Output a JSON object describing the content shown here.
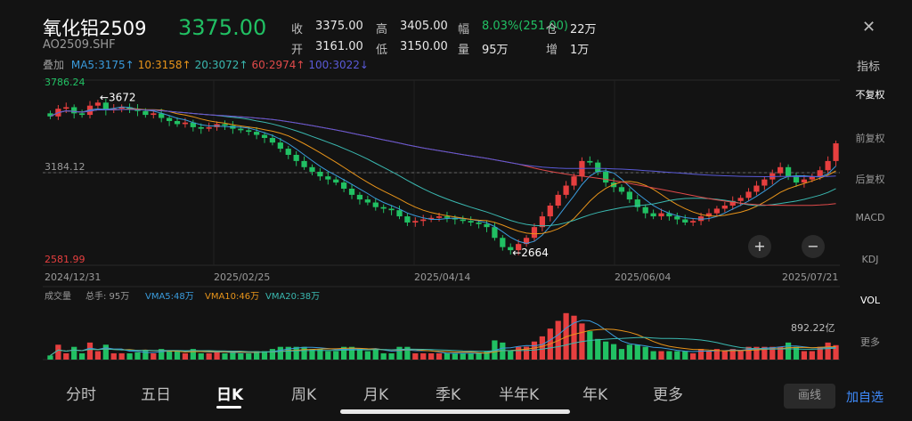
{
  "header": {
    "title": "氧化铝2509",
    "code": "AO2509.SHF",
    "price": "3375.00",
    "close_icon": "close-icon"
  },
  "quote": {
    "row1": [
      {
        "label": "收",
        "value": "3375.00"
      },
      {
        "label": "高",
        "value": "3405.00"
      },
      {
        "label": "幅",
        "value": "8.03%(251.00)"
      },
      {
        "label": "仓",
        "value": "22万"
      }
    ],
    "row2": [
      {
        "label": "开",
        "value": "3161.00"
      },
      {
        "label": "低",
        "value": "3150.00"
      },
      {
        "label": "量",
        "value": "95万"
      },
      {
        "label": "增",
        "value": "1万"
      }
    ]
  },
  "ma": {
    "overlay_label": "叠加",
    "items": [
      {
        "label": "MA5:",
        "value": "3175",
        "arrow": "↑",
        "color": "#3a9bdc"
      },
      {
        "label": "10:",
        "value": "3158",
        "arrow": "↑",
        "color": "#e8941a"
      },
      {
        "label": "20:",
        "value": "3072",
        "arrow": "↑",
        "color": "#3ab8b0"
      },
      {
        "label": "60:",
        "value": "2974",
        "arrow": "↑",
        "color": "#e04a4a"
      },
      {
        "label": "100:",
        "value": "3022",
        "arrow": "↓",
        "color": "#5a5ad8"
      }
    ]
  },
  "indicator_title": "指标",
  "right_menu": {
    "items": [
      "不复权",
      "前复权",
      "后复权",
      "MACD",
      "KDJ",
      "VOL",
      "更多"
    ],
    "active": [
      "不复权",
      "VOL"
    ]
  },
  "chart_labels": {
    "y_top": "3786.24",
    "y_mid": "3184.12",
    "y_bottom": "2581.99",
    "peak_label": "3672",
    "trough_label": "2664",
    "dates": [
      "2024/12/31",
      "2025/02/25",
      "2025/04/14",
      "2025/06/04",
      "2025/07/21"
    ]
  },
  "volume_header": {
    "title": "成交量",
    "total": "总手: 95万",
    "vma5": "VMA5:48万",
    "vma10": "VMA10:46万",
    "vma20": "VMA20:38万",
    "vol_label": "892.22亿"
  },
  "colors": {
    "up": "#e63f3f",
    "down": "#21c063",
    "ma5": "#3a9bdc",
    "ma10": "#e8941a",
    "ma20": "#3ab8b0",
    "ma60": "#e04a4a",
    "ma100": "#5a5ad8"
  },
  "bottom_tabs": {
    "items": [
      "分时",
      "五日",
      "日K",
      "周K",
      "月K",
      "季K",
      "半年K",
      "年K",
      "更多"
    ],
    "active": "日K"
  },
  "draw_button": "画线",
  "add_button": "加自选",
  "zoom": {
    "plus": "+",
    "minus": "−"
  },
  "chart_data": {
    "type": "candlestick",
    "period": "daily",
    "ylim": [
      2581.99,
      3786.24
    ],
    "reference_line": 3184.12,
    "dates_shown": [
      "2024/12/31",
      "2025/02/25",
      "2025/04/14",
      "2025/06/04",
      "2025/07/21"
    ],
    "high_marker": 3672,
    "low_marker": 2664,
    "last_close": 3375.0,
    "close_path": [
      3550,
      3600,
      3610,
      3570,
      3560,
      3620,
      3640,
      3590,
      3600,
      3610,
      3600,
      3585,
      3560,
      3570,
      3540,
      3520,
      3500,
      3510,
      3480,
      3470,
      3480,
      3500,
      3490,
      3470,
      3460,
      3450,
      3430,
      3410,
      3380,
      3340,
      3300,
      3260,
      3220,
      3190,
      3160,
      3140,
      3120,
      3080,
      3040,
      3010,
      2990,
      2960,
      2950,
      2940,
      2900,
      2860,
      2870,
      2880,
      2890,
      2900,
      2890,
      2880,
      2870,
      2860,
      2850,
      2830,
      2760,
      2700,
      2680,
      2720,
      2760,
      2830,
      2900,
      2970,
      3040,
      3100,
      3160,
      3260,
      3250,
      3190,
      3120,
      3090,
      3060,
      3010,
      2960,
      2920,
      2900,
      2920,
      2900,
      2880,
      2860,
      2870,
      2900,
      2920,
      2950,
      2970,
      3000,
      3020,
      3060,
      3100,
      3140,
      3180,
      3220,
      3160,
      3120,
      3140,
      3160,
      3200,
      3260,
      3375
    ],
    "ma_latest": {
      "MA5": 3175,
      "MA10": 3158,
      "MA20": 3072,
      "MA60": 2974,
      "MA100": 3022
    },
    "volume_latest": {
      "VMA5": "48万",
      "VMA10": "46万",
      "VMA20": "38万"
    }
  }
}
